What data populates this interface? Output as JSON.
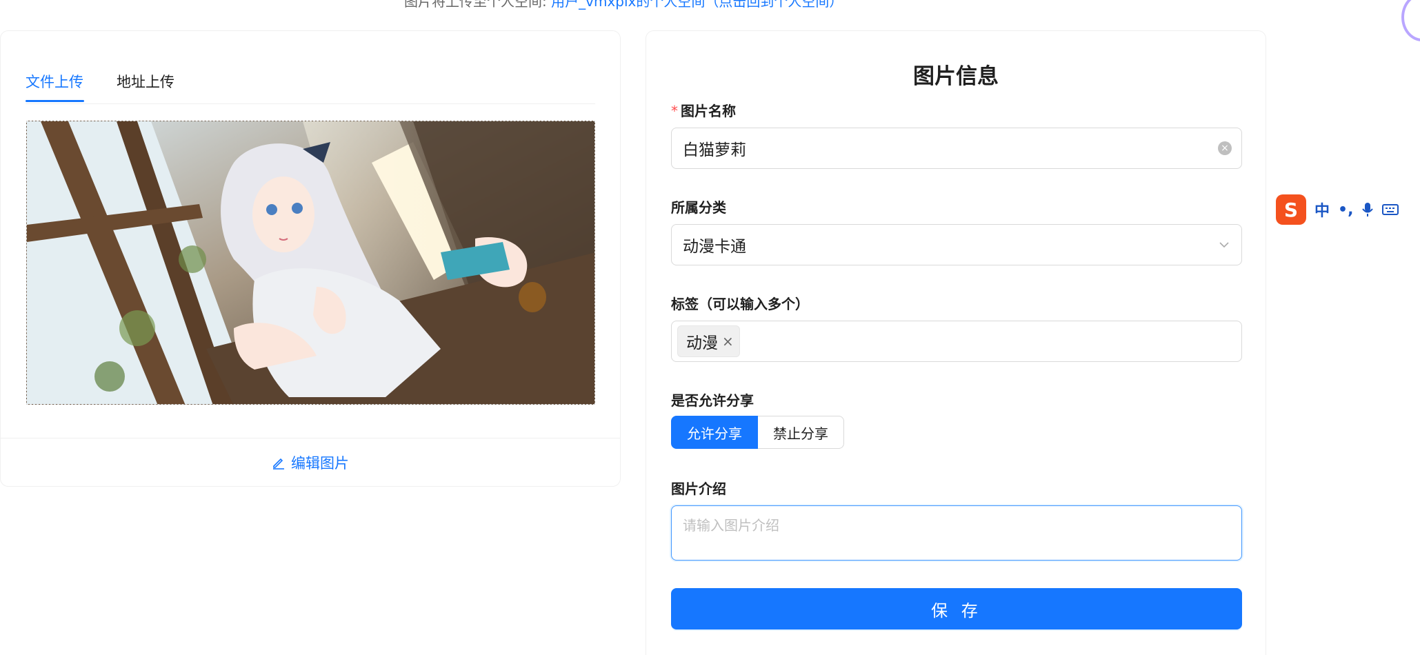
{
  "top_hint": {
    "prefix": "图片将上传至个人空间:",
    "link": "用户_vmxpix的个人空间（点击回到个人空间）"
  },
  "upload": {
    "tabs": [
      {
        "label": "文件上传",
        "active": true
      },
      {
        "label": "地址上传",
        "active": false
      }
    ],
    "edit_label": "编辑图片"
  },
  "form": {
    "title": "图片信息",
    "name": {
      "label": "图片名称",
      "required_mark": "*",
      "value": "白猫萝莉"
    },
    "category": {
      "label": "所属分类",
      "value": "动漫卡通"
    },
    "tags": {
      "label": "标签（可以输入多个）",
      "items": [
        "动漫"
      ]
    },
    "share": {
      "label": "是否允许分享",
      "options": [
        "允许分享",
        "禁止分享"
      ],
      "selected": "允许分享"
    },
    "intro": {
      "label": "图片介绍",
      "placeholder": "请输入图片介绍"
    },
    "save_label": "保 存"
  },
  "ime": {
    "logo": "S",
    "items": [
      "中",
      "•,",
      "mic-icon",
      "keyboard-icon"
    ]
  },
  "colors": {
    "primary": "#1677ff",
    "required": "#ff4d4f",
    "border": "#d9d9d9"
  }
}
